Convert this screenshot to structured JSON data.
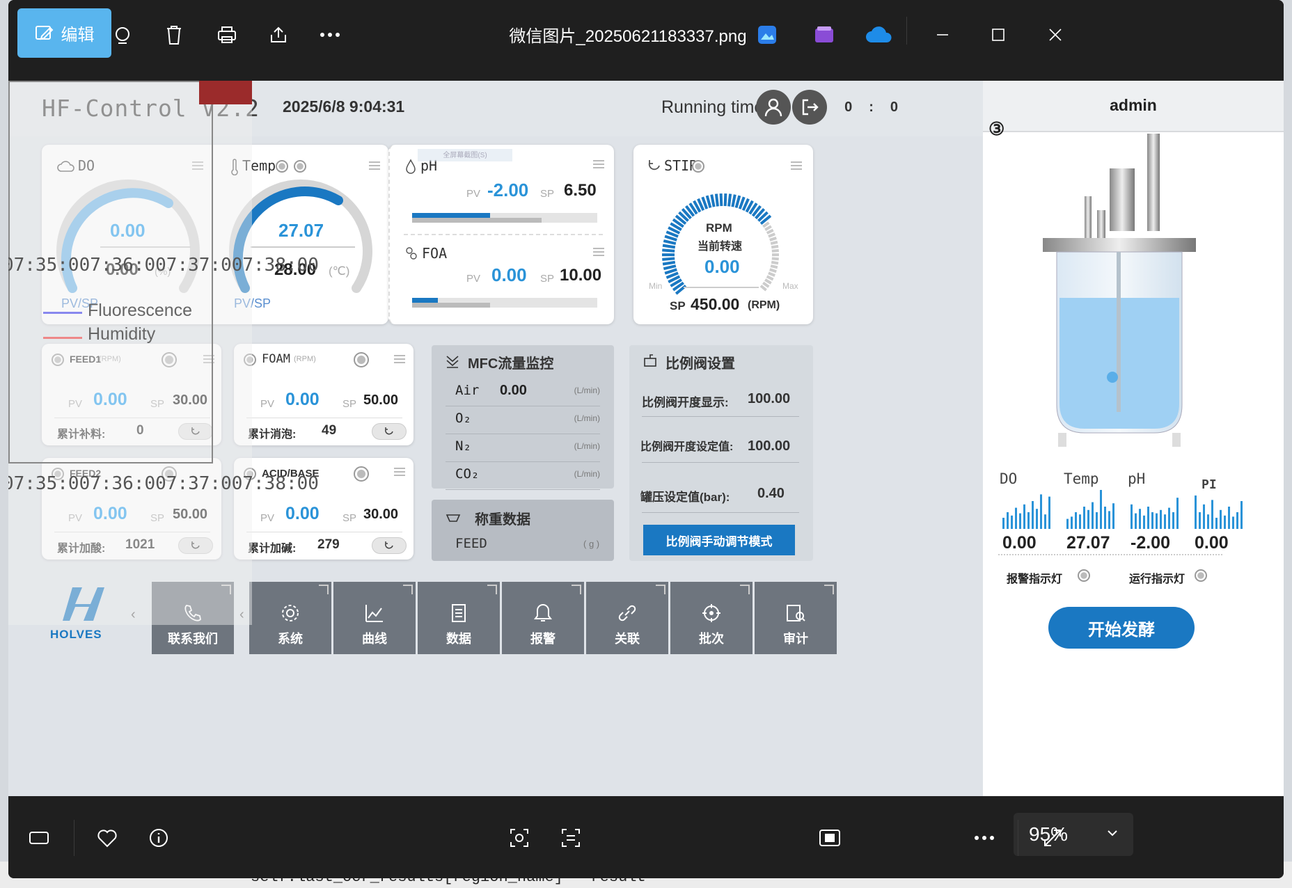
{
  "viewer": {
    "edit_label": "编辑",
    "filename": "微信图片_20250621183337.png",
    "zoom": "95%",
    "background_code": "self.last_ocr_results[region_name] = result"
  },
  "hmi": {
    "title": "HF-Control V2.2",
    "datetime": "2025/6/8 9:04:31",
    "running_time_label": "Running time",
    "running_time": [
      "0",
      "0",
      "0"
    ],
    "user": "admin",
    "badge": "③"
  },
  "gauges": {
    "do": {
      "label": "DO",
      "pv": "0.00",
      "sp": "0.00",
      "unit": "(%)",
      "pvsp": "PV/SP",
      "level": 0.78
    },
    "temp": {
      "label": "Temp",
      "pv": "27.07",
      "sp": "28.00",
      "unit": "(℃)",
      "pvsp": "PV/SP",
      "level": 0.62
    },
    "ph": {
      "label": "pH",
      "pv_label": "PV",
      "pv": "-2.00",
      "sp_label": "SP",
      "sp": "6.50",
      "level": 0.42
    },
    "foa": {
      "label": "FOA",
      "pv_label": "PV",
      "pv": "0.00",
      "sp_label": "SP",
      "sp": "10.00",
      "level": 0.14
    },
    "stir": {
      "label": "STIR",
      "rpm": "RPM",
      "rpm_cn": "当前转速",
      "pv": "0.00",
      "min": "Min",
      "max": "Max",
      "sp_label": "SP",
      "sp": "450.00",
      "sp_unit": "(RPM)"
    }
  },
  "pumps": {
    "feed1": {
      "label": "FEED1",
      "unit": "(RPM)",
      "pv_label": "PV",
      "pv": "0.00",
      "sp_label": "SP",
      "sp": "30.00",
      "total_label": "累计补料:",
      "total": "0"
    },
    "foam": {
      "label": "FOAM",
      "unit": "(RPM)",
      "pv_label": "PV",
      "pv": "0.00",
      "sp_label": "SP",
      "sp": "50.00",
      "total_label": "累计消泡:",
      "total": "49"
    },
    "feed2": {
      "label": "FEED2",
      "unit": "(RPM)",
      "pv_label": "PV",
      "pv": "0.00",
      "sp_label": "SP",
      "sp": "50.00",
      "total_label": "累计加酸:",
      "total": "1021"
    },
    "acidbase": {
      "label": "ACID/BASE",
      "pv_label": "PV",
      "pv": "0.00",
      "sp_label": "SP",
      "sp": "30.00",
      "total_label": "累计加碱:",
      "total": "279"
    }
  },
  "mfc": {
    "title": "MFC流量监控",
    "rows": [
      {
        "gas": "Air",
        "value": "0.00",
        "unit": "(L/min)"
      },
      {
        "gas": "O₂",
        "value": "",
        "unit": "(L/min)"
      },
      {
        "gas": "N₂",
        "value": "",
        "unit": "(L/min)"
      },
      {
        "gas": "CO₂",
        "value": "",
        "unit": "(L/min)"
      }
    ]
  },
  "weigh": {
    "title": "称重数据",
    "row": "FEED",
    "unit": "( g )"
  },
  "valve": {
    "title": "比例阀设置",
    "rows": [
      {
        "label": "比例阀开度显示:",
        "value": "100.00"
      },
      {
        "label": "比例阀开度设定值:",
        "value": "100.00"
      },
      {
        "label": "罐压设定值(bar):",
        "value": "0.40"
      }
    ],
    "button": "比例阀手动调节模式"
  },
  "mini": [
    {
      "label": "DO",
      "value": "0.00"
    },
    {
      "label": "Temp",
      "value": "27.07"
    },
    {
      "label": "pH",
      "value": "-2.00"
    },
    {
      "label": "PI",
      "value": "0.00"
    }
  ],
  "indicators": {
    "alarm": "报警指示灯",
    "run": "运行指示灯"
  },
  "start_button": "开始发酵",
  "nav": {
    "logo_text": "HOLVES",
    "contact": "联系我们",
    "items": [
      "系统",
      "曲线",
      "数据",
      "报警",
      "关联",
      "批次",
      "审计"
    ]
  },
  "overlay": {
    "times": "07:35:007:36:007:37:007:38:00",
    "legend": [
      "Fluorescence",
      "Humidity"
    ],
    "hint": "全屏幕截图(S)"
  },
  "colors": {
    "accent": "#1a78c2",
    "gauge_blue": "#2aa3f0",
    "edit_blue": "#59b5ee"
  }
}
